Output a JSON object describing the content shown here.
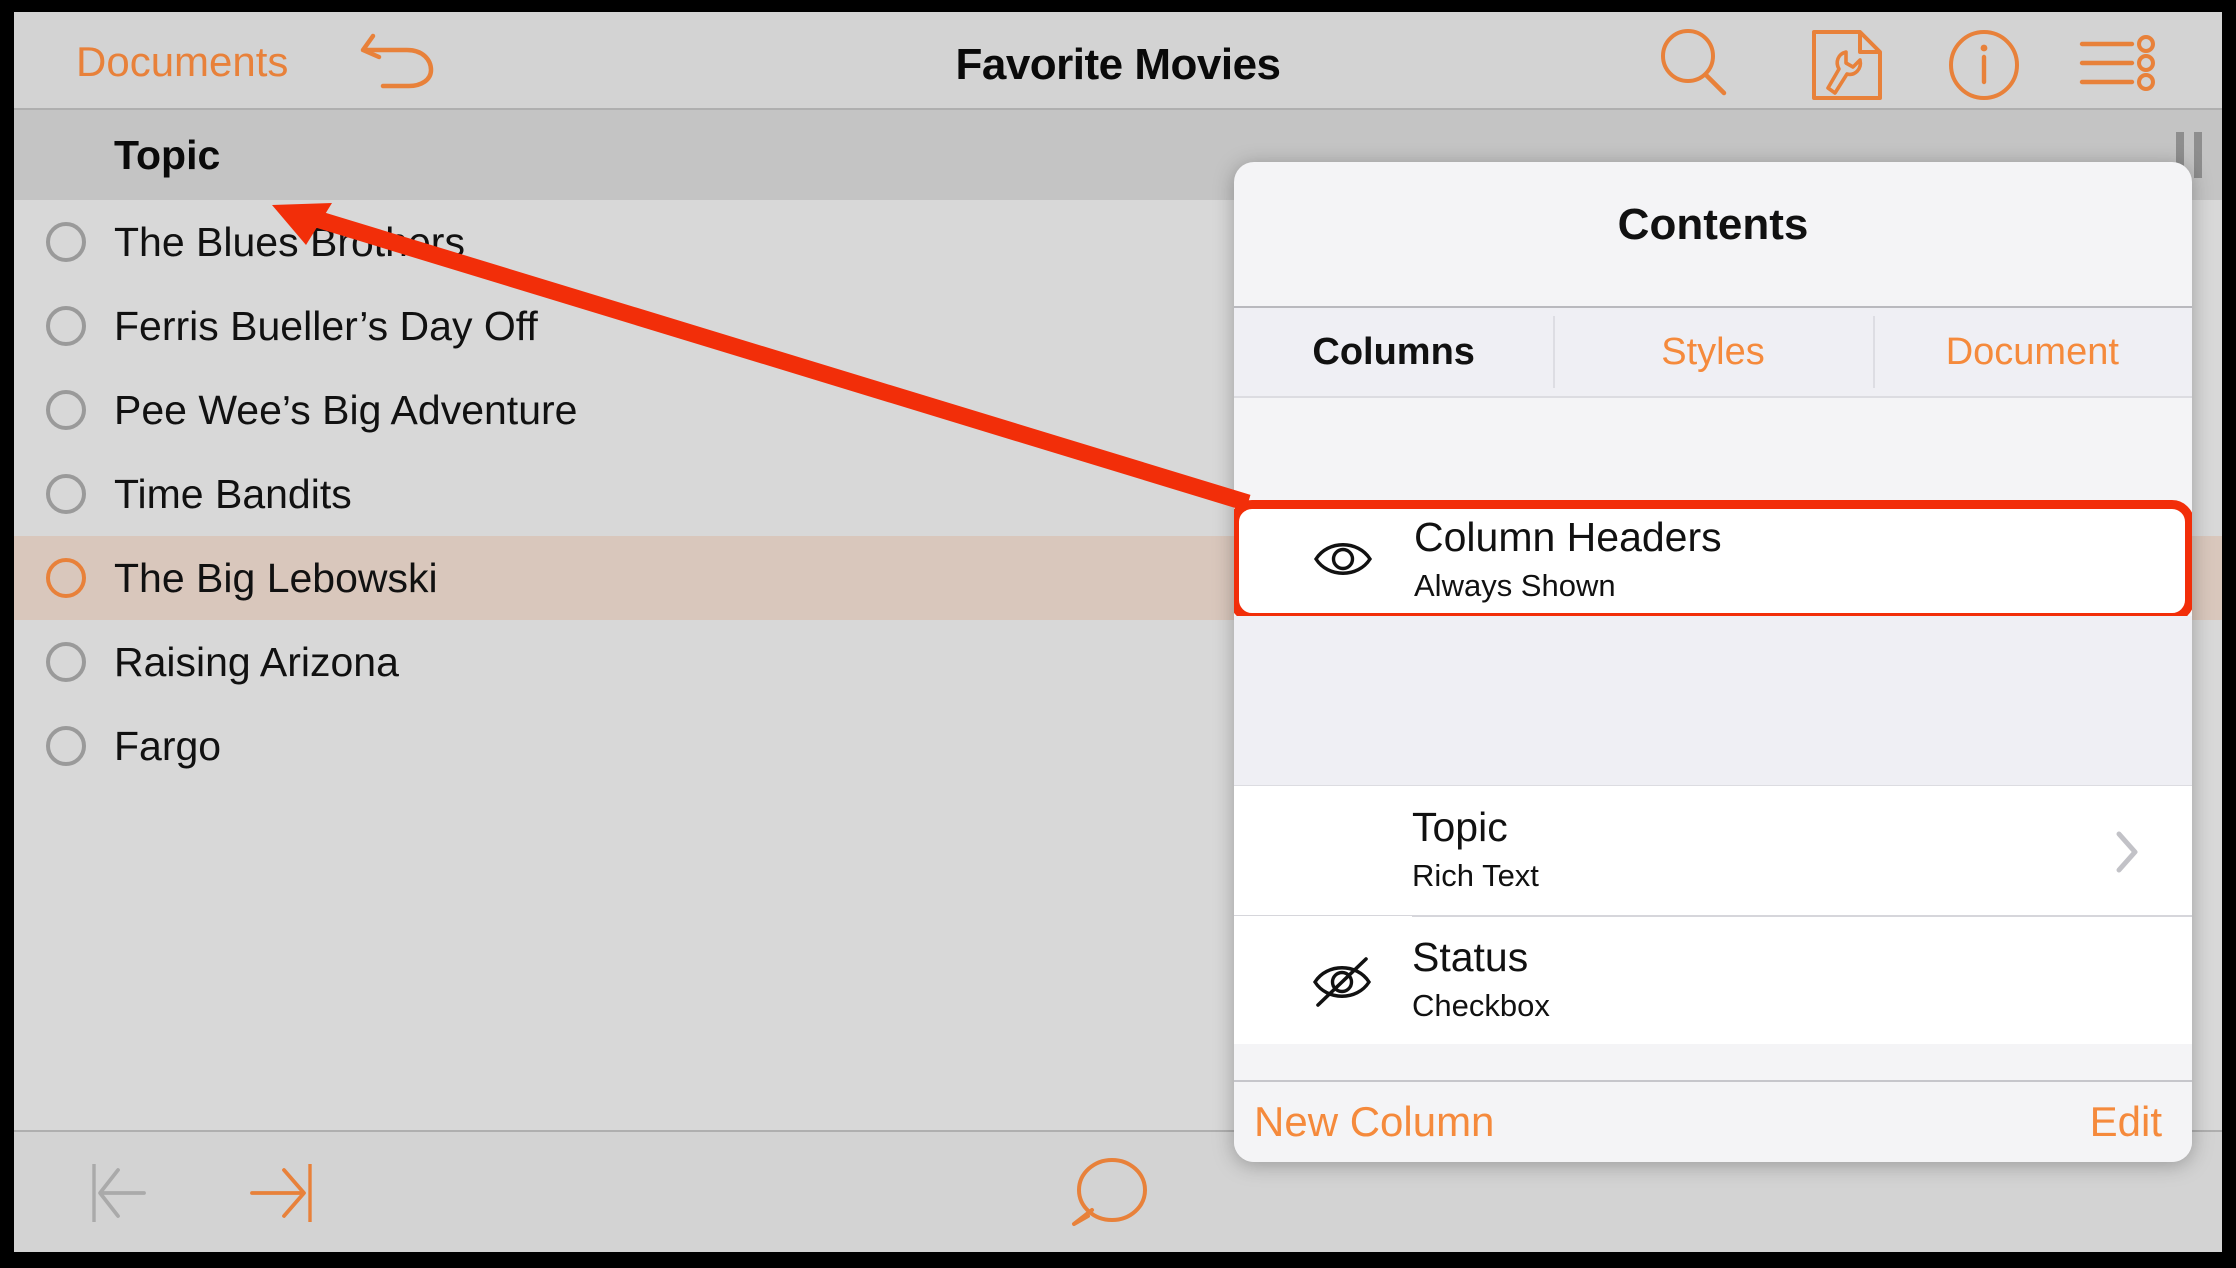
{
  "toolbar": {
    "back_label": "Documents",
    "title": "Favorite Movies",
    "undo_icon": "undo-arrow-icon",
    "search_icon": "search-icon",
    "contents_icon": "document-wrench-icon",
    "info_icon": "info-circle-icon",
    "list_icon": "list-options-icon"
  },
  "outline": {
    "column_header": "Topic",
    "rows": [
      {
        "label": "The Blues Brothers",
        "selected": false
      },
      {
        "label": "Ferris Bueller’s Day Off",
        "selected": false
      },
      {
        "label": "Pee Wee’s Big Adventure",
        "selected": false
      },
      {
        "label": "Time Bandits",
        "selected": false
      },
      {
        "label": "The Big Lebowski",
        "selected": true
      },
      {
        "label": "Raising Arizona",
        "selected": false
      },
      {
        "label": "Fargo",
        "selected": false
      }
    ]
  },
  "bottombar": {
    "outdent_icon": "outdent-arrow-icon",
    "indent_icon": "indent-arrow-icon",
    "comment_icon": "comment-bubble-icon"
  },
  "popover": {
    "title": "Contents",
    "tabs": [
      {
        "label": "Columns",
        "active": true
      },
      {
        "label": "Styles",
        "active": false
      },
      {
        "label": "Document",
        "active": false
      }
    ],
    "column_headers_item": {
      "title": "Column Headers",
      "subtitle": "Always Shown",
      "icon": "eye-visible-icon",
      "highlighted": true
    },
    "columns": [
      {
        "title": "Topic",
        "subtitle": "Rich Text",
        "icon": "none",
        "chevron": "chevron-right-icon"
      },
      {
        "title": "Status",
        "subtitle": "Checkbox",
        "icon": "eye-hidden-icon",
        "chevron": "none"
      }
    ],
    "footer": {
      "new_column_label": "New Column",
      "edit_label": "Edit"
    }
  },
  "annotation": {
    "color": "#F22E09",
    "description": "arrow-pointing-from-column-headers-to-topic-header"
  },
  "colors": {
    "accent_orange": "#E8813A",
    "tab_orange": "#F58A3C",
    "annotation_red": "#F22E09",
    "toolbar_gray": "#D3D3D3",
    "header_band_gray": "#C4C4C4",
    "list_gray": "#D8D8D8",
    "selected_row": "#D9C7BC",
    "popover_bg": "#F4F4F6"
  }
}
